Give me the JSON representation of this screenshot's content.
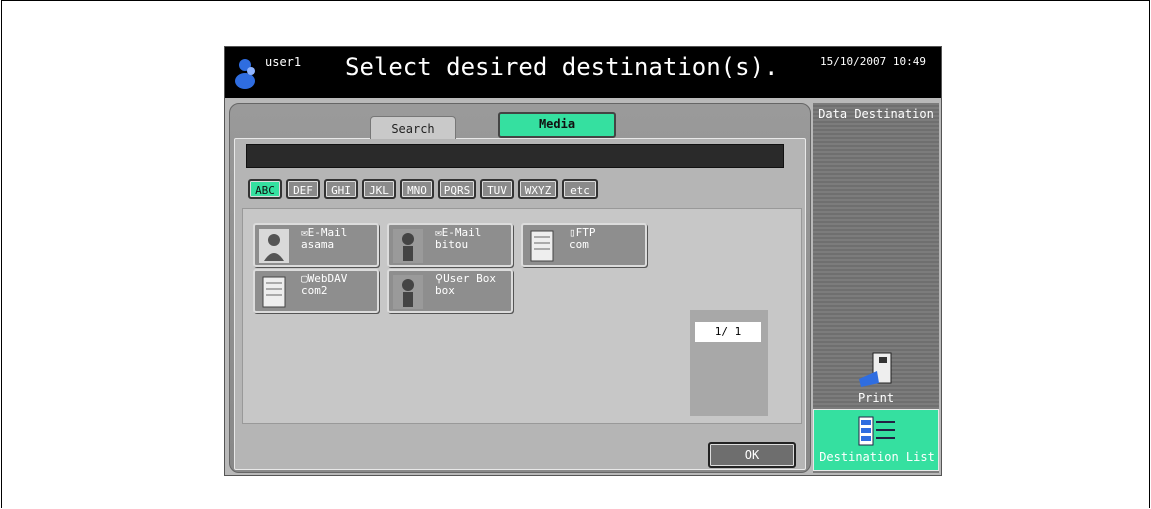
{
  "header": {
    "user": "user1",
    "title": "Select desired destination(s).",
    "datetime": "15/10/2007 10:49"
  },
  "tabs": {
    "search_label": "Search",
    "media_label": "Media"
  },
  "search": {
    "value": ""
  },
  "index_buttons": [
    "ABC",
    "DEF",
    "GHI",
    "JKL",
    "MNO",
    "PQRS",
    "TUV",
    "WXYZ",
    "etc"
  ],
  "active_index": "ABC",
  "destinations": [
    {
      "type": "E-Mail",
      "name": "asama",
      "icon": "person-icon"
    },
    {
      "type": "E-Mail",
      "name": "bitou",
      "icon": "person-icon"
    },
    {
      "type": "FTP",
      "name": "com",
      "icon": "server-icon"
    },
    {
      "type": "WebDAV",
      "name": "com2",
      "icon": "server-icon"
    },
    {
      "type": "User Box",
      "name": "box",
      "icon": "person-icon"
    }
  ],
  "pager": {
    "text": "1/  1"
  },
  "footer": {
    "ok_label": "OK"
  },
  "side_panel": {
    "title": "Data Destination",
    "print_label": "Print",
    "dest_list_label": "Destination List"
  },
  "colors": {
    "accent": "#35e0a0",
    "panel": "#9a9a9a"
  }
}
